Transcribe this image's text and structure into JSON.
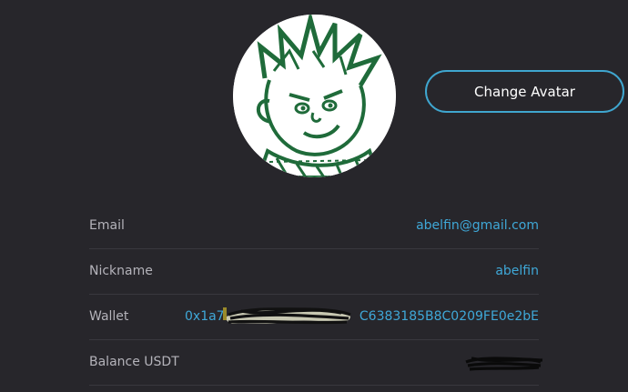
{
  "profile": {
    "change_avatar_label": "Change Avatar"
  },
  "fields": {
    "email": {
      "label": "Email",
      "value": "abelfin@gmail.com"
    },
    "nickname": {
      "label": "Nickname",
      "value": "abelfin"
    },
    "wallet": {
      "label": "Wallet",
      "value_start": "0x1a7",
      "value_end": "C6383185B8C0209FE0e2bE"
    },
    "balance": {
      "label": "Balance USDT"
    }
  },
  "colors": {
    "background": "#27262b",
    "accent": "#3fa6cf",
    "link": "#3fa8d8",
    "avatar_ink": "#1f6b3a"
  }
}
